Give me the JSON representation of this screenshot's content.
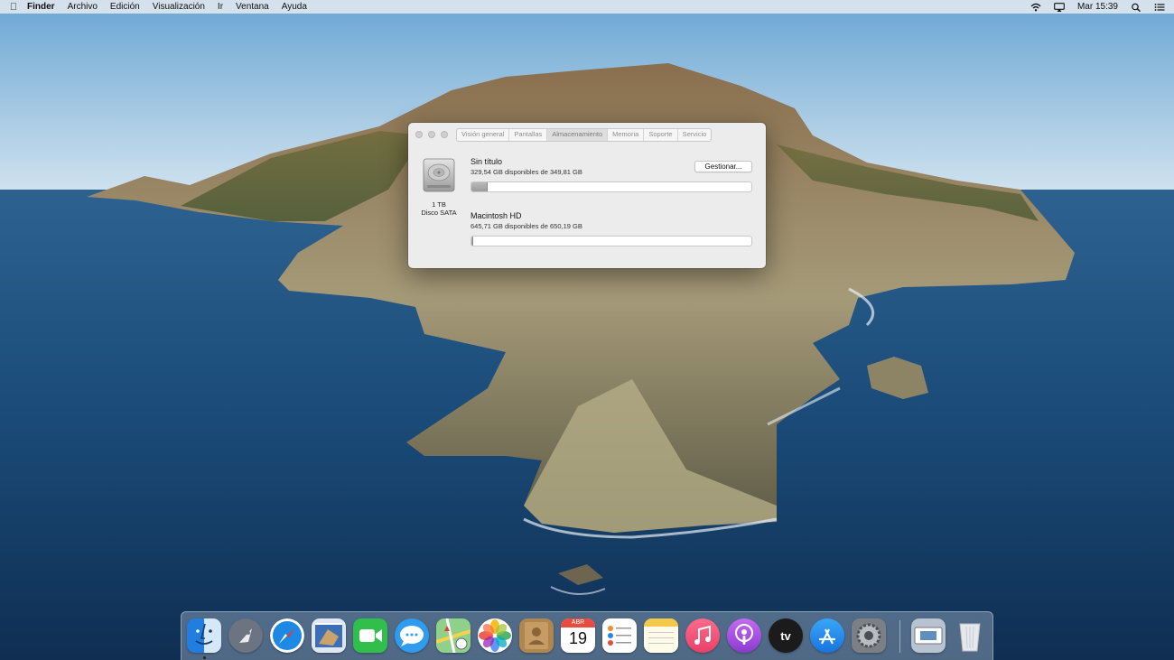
{
  "menubar": {
    "app_name": "Finder",
    "menus": [
      "Archivo",
      "Edición",
      "Visualización",
      "Ir",
      "Ventana",
      "Ayuda"
    ],
    "clock": "Mar 15:39",
    "icons": [
      "apple-icon",
      "wifi-icon",
      "airplay-icon",
      "spotlight-icon",
      "notification-center-icon"
    ]
  },
  "about_window": {
    "tabs": [
      "Visión general",
      "Pantallas",
      "Almacenamiento",
      "Memoria",
      "Soporte",
      "Servicio"
    ],
    "active_tab": "Almacenamiento",
    "disk": {
      "size": "1 TB",
      "type": "Disco SATA",
      "icon": "hard-disk-icon"
    },
    "manage_button": "Gestionar...",
    "volumes": [
      {
        "name": "Sin título",
        "info": "329,54 GB disponibles de 349,81 GB",
        "used_fraction": 0.058
      },
      {
        "name": "Macintosh HD",
        "info": "645,71 GB disponibles de 650,19 GB",
        "used_fraction": 0.007
      }
    ]
  },
  "dock": {
    "items": [
      {
        "name": "finder",
        "icon": "finder-icon",
        "color": "#2f8fe8"
      },
      {
        "name": "launchpad",
        "icon": "launchpad-icon",
        "color": "#6b7480"
      },
      {
        "name": "safari",
        "icon": "safari-icon",
        "color": "#1e88e5"
      },
      {
        "name": "mail",
        "icon": "mail-icon",
        "color": "#3d6fb6"
      },
      {
        "name": "facetime",
        "icon": "facetime-icon",
        "color": "#2fbf4a"
      },
      {
        "name": "messages",
        "icon": "messages-icon",
        "color": "#2f9cf0"
      },
      {
        "name": "maps",
        "icon": "maps-icon",
        "color": "#7cc47a"
      },
      {
        "name": "photos",
        "icon": "photos-icon",
        "color": "#ffffff"
      },
      {
        "name": "contacts",
        "icon": "contacts-icon",
        "color": "#b0864f"
      },
      {
        "name": "calendar",
        "icon": "calendar-icon",
        "color": "#ffffff",
        "month": "ABR",
        "day": "19"
      },
      {
        "name": "reminders",
        "icon": "reminders-icon",
        "color": "#ffffff"
      },
      {
        "name": "notes",
        "icon": "notes-icon",
        "color": "#fbe27a"
      },
      {
        "name": "music",
        "icon": "music-icon",
        "color": "#fa5a7a"
      },
      {
        "name": "podcasts",
        "icon": "podcasts-icon",
        "color": "#a24ee0"
      },
      {
        "name": "tv",
        "icon": "apple-tv-icon",
        "color": "#1b1b1b",
        "label": "tv"
      },
      {
        "name": "app-store",
        "icon": "app-store-icon",
        "color": "#1c8cf2"
      },
      {
        "name": "system-preferences",
        "icon": "gear-icon",
        "color": "#7c7f85"
      },
      {
        "name": "downloads-stack",
        "icon": "downloads-stack-icon",
        "color": "#b8c3cf"
      },
      {
        "name": "trash",
        "icon": "trash-icon",
        "color": "#e6e9ec"
      }
    ]
  }
}
